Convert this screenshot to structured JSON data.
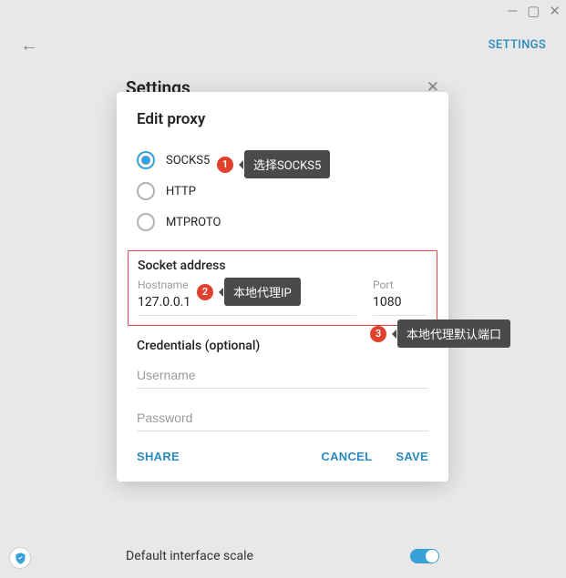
{
  "window": {
    "min": "—",
    "max": "▢",
    "close": "✕"
  },
  "topbar": {
    "settings_link": "SETTINGS"
  },
  "panel": {
    "title": "Settings",
    "bg_row_label": "Default interface scale"
  },
  "modal": {
    "title": "Edit proxy",
    "radio_socks5": "SOCKS5",
    "radio_http": "HTTP",
    "radio_mtproto": "MTPROTO",
    "socket_section": "Socket address",
    "host_label": "Hostname",
    "host_value": "127.0.0.1",
    "port_label": "Port",
    "port_value": "1080",
    "cred_section": "Credentials (optional)",
    "username_placeholder": "Username",
    "password_placeholder": "Password",
    "share": "SHARE",
    "cancel": "CANCEL",
    "save": "SAVE"
  },
  "callouts": {
    "c1_num": "1",
    "c1_text": "选择SOCKS5",
    "c2_num": "2",
    "c2_text": "本地代理IP",
    "c3_num": "3",
    "c3_text": "本地代理默认端口"
  }
}
